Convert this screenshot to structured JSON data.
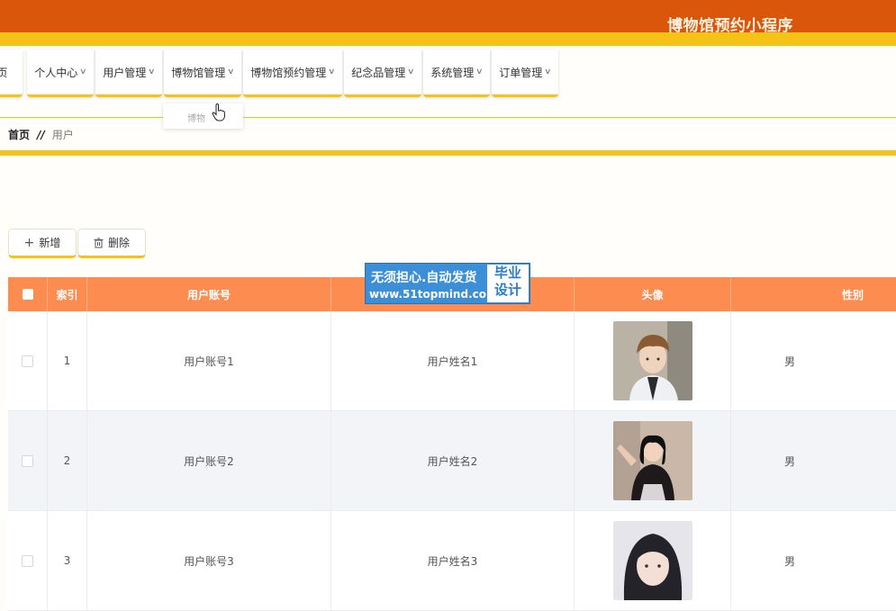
{
  "header": {
    "title": "博物馆预约小程序"
  },
  "nav": {
    "items": [
      {
        "label": "页",
        "has_chevron": false
      },
      {
        "label": "个人中心"
      },
      {
        "label": "用户管理"
      },
      {
        "label": "博物馆管理"
      },
      {
        "label": "博物馆预约管理"
      },
      {
        "label": "纪念品管理"
      },
      {
        "label": "系统管理"
      },
      {
        "label": "订单管理"
      }
    ],
    "dropdown": {
      "item": "博物"
    }
  },
  "breadcrumb": {
    "home": "首页",
    "separator": "//",
    "current": "用户"
  },
  "toolbar": {
    "add_label": "新增",
    "delete_label": "删除"
  },
  "table": {
    "columns": [
      "索引",
      "用户账号",
      "",
      "头像",
      "性别"
    ],
    "rows": [
      {
        "index": "1",
        "account": "用户账号1",
        "name": "用户姓名1",
        "gender": "男"
      },
      {
        "index": "2",
        "account": "用户账号2",
        "name": "用户姓名2",
        "gender": "男"
      },
      {
        "index": "3",
        "account": "用户账号3",
        "name": "用户姓名3",
        "gender": "男"
      }
    ]
  },
  "watermark": {
    "line1": "无须担心.自动发货",
    "line2": "www.51topmind.com",
    "side1": "毕业",
    "side2": "设计"
  },
  "colors": {
    "header": "#d9560b",
    "accent": "#f5c216",
    "table_header": "#fd8c50"
  }
}
